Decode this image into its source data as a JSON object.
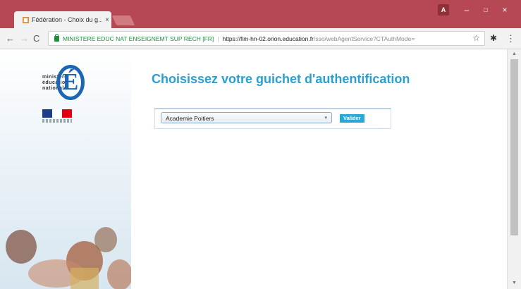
{
  "browser": {
    "tab_title": "Fédération - Choix du g...",
    "tab_close": "×",
    "window_user": "A",
    "window_min": "–",
    "window_max": "□",
    "window_close": "×",
    "nav_back": "←",
    "nav_forward": "→",
    "nav_reload": "C",
    "site_name": "MINISTERE EDUC NAT ENSEIGNEMT SUP RECH [FR]",
    "separator": "|",
    "url_host": "https://fim-hn-02.orion.education.fr",
    "url_path": "/sso/webAgentService?CTAuthMode=",
    "star": "☆",
    "extension": "✱",
    "menu": "⋮"
  },
  "sidebar": {
    "logo_text": "ministère\néducation\nnationale",
    "logo_letter": "É"
  },
  "page": {
    "title": "Choisissez votre guichet d'authentification",
    "select_value": "Academie Poitiers",
    "select_chevron": "▾",
    "submit_label": "Valider"
  },
  "colors": {
    "accent": "#2a9fd0",
    "chrome": "#b64853",
    "flag_blue": "#1e3d8f",
    "flag_white": "#ffffff",
    "flag_red": "#e1000f"
  },
  "icons": [
    "lock-icon",
    "star-icon",
    "extension-icon",
    "menu-icon",
    "back-arrow-icon",
    "forward-arrow-icon",
    "reload-icon",
    "chevron-down-icon"
  ]
}
